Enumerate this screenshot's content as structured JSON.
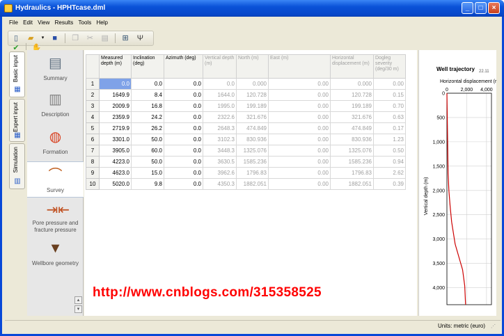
{
  "window": {
    "title": "Hydraulics - HPHTcase.dml"
  },
  "menu": [
    "File",
    "Edit",
    "View",
    "Results",
    "Tools",
    "Help"
  ],
  "toolbar_icons": [
    "new-file-icon",
    "open-folder-icon",
    "dropdown-arrow-icon",
    "save-icon",
    "copy-icon",
    "cut-icon",
    "paste-icon",
    "settings-tree-icon",
    "well-icon",
    "check-circle-icon",
    "run-hand-icon"
  ],
  "vertical_tabs": [
    {
      "label": "Basic input",
      "icon": "basic-input-icon",
      "active": true
    },
    {
      "label": "Expert input",
      "icon": "expert-input-icon",
      "active": false
    },
    {
      "label": "Simulation",
      "icon": "simulation-icon",
      "active": false
    }
  ],
  "sidebar": {
    "items": [
      {
        "label": "Summary",
        "icon": "summary-chart-icon"
      },
      {
        "label": "Description",
        "icon": "description-doc-icon"
      },
      {
        "label": "Formation",
        "icon": "formation-globe-icon"
      },
      {
        "label": "Survey",
        "icon": "survey-pipe-icon"
      },
      {
        "label": "Pore pressure and fracture pressure",
        "icon": "pressure-arrows-icon"
      },
      {
        "label": "Wellbore geometry",
        "icon": "wellbore-geometry-icon"
      }
    ],
    "active_index": 3
  },
  "table": {
    "columns": [
      {
        "label": "Measured depth (m)",
        "editable": true
      },
      {
        "label": "Inclination (deg)",
        "editable": true
      },
      {
        "label": "Azimuth (deg)",
        "editable": true
      },
      {
        "label": "Vertical depth (m)",
        "editable": false
      },
      {
        "label": "North (m)",
        "editable": false
      },
      {
        "label": "East (m)",
        "editable": false
      },
      {
        "label": "Horizontal displacement (m)",
        "editable": false
      },
      {
        "label": "Dogleg severity (deg/30 m)",
        "editable": false
      }
    ],
    "rows": [
      [
        "1",
        "0.0",
        "0.0",
        "0.0",
        "0.0",
        "0.000",
        "0.00",
        "0.000",
        "0.00"
      ],
      [
        "2",
        "1649.9",
        "8.4",
        "0.0",
        "1644.0",
        "120.728",
        "0.00",
        "120.728",
        "0.15"
      ],
      [
        "3",
        "2009.9",
        "16.8",
        "0.0",
        "1995.0",
        "199.189",
        "0.00",
        "199.189",
        "0.70"
      ],
      [
        "4",
        "2359.9",
        "24.2",
        "0.0",
        "2322.6",
        "321.676",
        "0.00",
        "321.676",
        "0.63"
      ],
      [
        "5",
        "2719.9",
        "26.2",
        "0.0",
        "2648.3",
        "474.849",
        "0.00",
        "474.849",
        "0.17"
      ],
      [
        "6",
        "3301.0",
        "50.0",
        "0.0",
        "3102.3",
        "830.936",
        "0.00",
        "830.936",
        "1.23"
      ],
      [
        "7",
        "3905.0",
        "60.0",
        "0.0",
        "3448.3",
        "1325.076",
        "0.00",
        "1325.076",
        "0.50"
      ],
      [
        "8",
        "4223.0",
        "50.0",
        "0.0",
        "3630.5",
        "1585.236",
        "0.00",
        "1585.236",
        "0.94"
      ],
      [
        "9",
        "4623.0",
        "15.0",
        "0.0",
        "3962.6",
        "1796.83",
        "0.00",
        "1796.83",
        "2.62"
      ],
      [
        "10",
        "5020.0",
        "9.8",
        "0.0",
        "4350.3",
        "1882.051",
        "0.00",
        "1882.051",
        "0.39"
      ]
    ]
  },
  "chart_data": {
    "type": "line",
    "title": "Well trajectory",
    "title_badge": "22.11",
    "xlabel": "Horizontal displacement (r",
    "ylabel": "Vertical depth (m)",
    "x_ticks": [
      "0",
      "2,000",
      "4,000"
    ],
    "y_ticks": [
      "0",
      "500",
      "1,000",
      "1,500",
      "2,000",
      "2,500",
      "3,000",
      "3,500",
      "4,000"
    ],
    "xlim": [
      0,
      4500
    ],
    "ylim": [
      0,
      4350
    ],
    "y_inverted": true,
    "series": [
      {
        "color": "#cc0000",
        "x": [
          0,
          120.728,
          199.189,
          321.676,
          474.849,
          830.936,
          1325.076,
          1585.236,
          1796.83,
          1882.051
        ],
        "y": [
          0,
          1644.0,
          1995.0,
          2322.6,
          2648.3,
          3102.3,
          3448.3,
          3630.5,
          3962.6,
          4350.3
        ]
      }
    ]
  },
  "watermark": "http://www.cnblogs.com/315358525",
  "status": {
    "units": "Units: metric (euro)"
  }
}
